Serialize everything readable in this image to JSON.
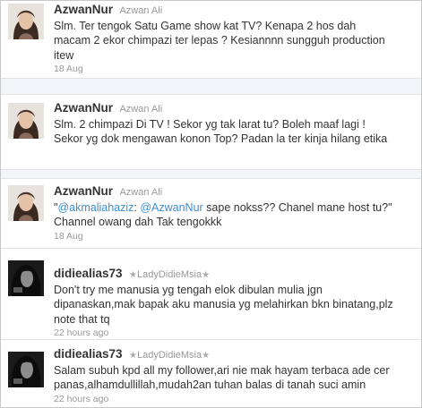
{
  "tweets": [
    {
      "username": "AzwanNur",
      "fullname": "Azwan Ali",
      "lines": [
        "Slm. Ter tengok Satu Game show kat TV? Kenapa 2 hos dah",
        "macam 2 ekor chimpazi ter lepas ? Kesiannnn sungguh production",
        "itew"
      ],
      "time": "18 Aug"
    },
    {
      "username": "AzwanNur",
      "fullname": "Azwan Ali",
      "lines": [
        "Slm. 2 chimpazi Di TV ! Sekor yg tak larat tu? Boleh maaf lagi !",
        "Sekor yg dok mengawan konon Top? Padan la ter kinja hilang etika"
      ],
      "time": "18 Aug"
    },
    {
      "username": "AzwanNur",
      "fullname": "Azwan Ali",
      "line1_pre": "\"",
      "mention1": "@akmaliahaziz",
      "line1_mid": ": ",
      "mention2": "@AzwanNur",
      "line1_post": " sape nokss?? Chanel mane host tu?\"",
      "line2": "Channel owang dah Tak tengokkk",
      "time": "18 Aug"
    },
    {
      "username": "didiealias73",
      "fullname": "LadyDidieMsia",
      "lines": [
        "Don't try me manusia yg tengah elok dibulan mulia jgn",
        "dipanaskan,mak bapak aku manusia yg melahirkan bkn binatang,plz",
        "note that tq"
      ],
      "time": "22 hours ago"
    },
    {
      "username": "didiealias73",
      "fullname": "LadyDidieMsia",
      "lines": [
        "Salam subuh kpd all my follower,ari nie mak hayam terbaca ade cer",
        "panas,alhamdullillah,mudah2an tuhan balas di tanah suci amin"
      ],
      "time": "22 hours ago"
    }
  ],
  "colors": {
    "link": "#3f8ed0",
    "text": "#333333",
    "meta": "#999999"
  },
  "icons": {
    "star": "★"
  }
}
